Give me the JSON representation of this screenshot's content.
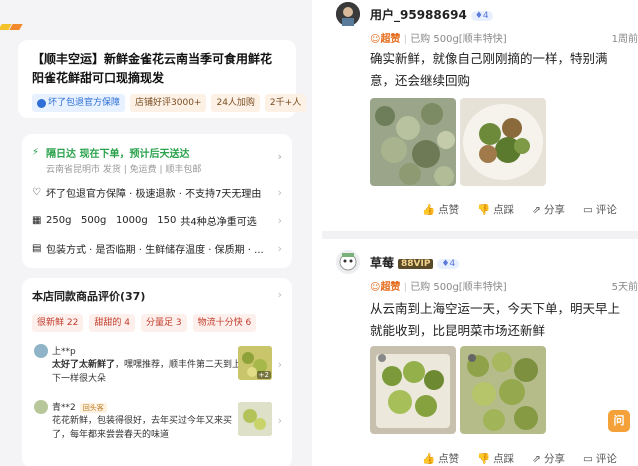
{
  "product": {
    "title": "【顺丰空运】新鲜金雀花云南当季可食用鲜花阳雀花鲜甜可口现摘现发",
    "tags": [
      "坏了包退官方保障",
      "店铺好评3000+",
      "24人加购",
      "2千+人"
    ]
  },
  "info": {
    "shipping_title": "隔日达 现在下单，预计后天送达",
    "shipping_sub": "云南省昆明市 发货 | 免运费 | 顺丰包邮",
    "guarantee": "坏了包退官方保障 · 极速退款 · 不支持7天无理由",
    "specs": "250g   500g   1000g   150",
    "specs_count": "共4种总净重可选",
    "package": "包装方式 · 是否临期 · 生鲜储存温度 · 保质期 · ..."
  },
  "reviews": {
    "title": "本店同款商品评价(37)",
    "tags": [
      {
        "label": "很新鲜",
        "count": "22"
      },
      {
        "label": "甜甜的",
        "count": "4"
      },
      {
        "label": "分量足",
        "count": "3"
      },
      {
        "label": "物流十分快",
        "count": "6"
      }
    ],
    "items": [
      {
        "user": "上**p",
        "badge": "",
        "text_bold": "太好了太新鲜了",
        "text": "，嘿嘿推荐，顺丰件第二天到上下一样很大朵",
        "img_count": "+2"
      },
      {
        "user": "青**2",
        "badge": "回头客",
        "text_bold": "",
        "text": "花花新鲜，包装得很好，去年买过今年又来买了，每年都来尝尝春天的味道",
        "img_count": ""
      }
    ]
  },
  "posts": [
    {
      "user": "用户_95988694",
      "vip": "",
      "level": "4",
      "rating": "超赞",
      "spec": "已购 500g[顺丰特快]",
      "time": "1周前",
      "text": "确实新鲜，就像自己刚刚摘的一样，特别满意，还会继续回购",
      "actions": [
        "点赞",
        "点踩",
        "分享",
        "评论"
      ]
    },
    {
      "user": "草莓",
      "vip": "88VIP",
      "level": "4",
      "rating": "超赞",
      "spec": "已购 500g[顺丰特快]",
      "time": "5天前",
      "text": "从云南到上海空运一天，今天下单，明天早上就能收到，比昆明菜市场还新鲜",
      "actions": [
        "点赞",
        "点踩",
        "分享",
        "评论"
      ]
    }
  ],
  "fab_label": "问",
  "colors": {
    "accent": "#e56b1a",
    "green": "#2aa24b",
    "tag_red": "#c23a2a"
  }
}
